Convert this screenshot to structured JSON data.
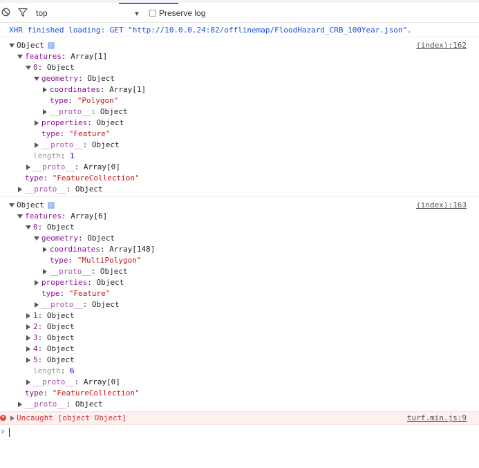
{
  "toolbar": {
    "context_label": "top",
    "preserve_log_label": "Preserve log",
    "preserve_log_checked": false
  },
  "xhr_message": "XHR finished loading: GET \"http://10.0.0.24:82/offlinemap/FloodHazard_CRB_100Year.json\".",
  "log1": {
    "source": "(index):162",
    "lines": {
      "root": "Object",
      "features_key": "features",
      "features_val": "Array[1]",
      "item0_key": "0",
      "item0_val": "Object",
      "geometry_key": "geometry",
      "geometry_val": "Object",
      "coordinates_key": "coordinates",
      "coordinates_val": "Array[1]",
      "gtype_key": "type",
      "gtype_val": "\"Polygon\"",
      "gproto_key": "__proto__",
      "gproto_val": "Object",
      "properties_key": "properties",
      "properties_val": "Object",
      "ftype_key": "type",
      "ftype_val": "\"Feature\"",
      "fproto_key": "__proto__",
      "fproto_val": "Object",
      "length_key": "length",
      "length_val": "1",
      "aproto_key": "__proto__",
      "aproto_val": "Array[0]",
      "type_key": "type",
      "type_val": "\"FeatureCollection\"",
      "proto_key": "__proto__",
      "proto_val": "Object"
    }
  },
  "log2": {
    "source": "(index):163",
    "lines": {
      "root": "Object",
      "features_key": "features",
      "features_val": "Array[6]",
      "item0_key": "0",
      "item0_val": "Object",
      "geometry_key": "geometry",
      "geometry_val": "Object",
      "coordinates_key": "coordinates",
      "coordinates_val": "Array[148]",
      "gtype_key": "type",
      "gtype_val": "\"MultiPolygon\"",
      "gproto_key": "__proto__",
      "gproto_val": "Object",
      "properties_key": "properties",
      "properties_val": "Object",
      "ftype_key": "type",
      "ftype_val": "\"Feature\"",
      "fproto_key": "__proto__",
      "fproto_val": "Object",
      "items": [
        {
          "key": "1",
          "val": "Object"
        },
        {
          "key": "2",
          "val": "Object"
        },
        {
          "key": "3",
          "val": "Object"
        },
        {
          "key": "4",
          "val": "Object"
        },
        {
          "key": "5",
          "val": "Object"
        }
      ],
      "length_key": "length",
      "length_val": "6",
      "aproto_key": "__proto__",
      "aproto_val": "Array[0]",
      "type_key": "type",
      "type_val": "\"FeatureCollection\"",
      "proto_key": "__proto__",
      "proto_val": "Object"
    }
  },
  "error": {
    "icon": "error-x-icon",
    "message": "Uncaught [object Object]",
    "source": "turf.min.js:9"
  },
  "info_badge_glyph": "i",
  "colors": {
    "key": "#881391",
    "string": "#c41a16",
    "number": "#1c00cf",
    "xhr": "#1b4fd8",
    "error": "#d32f2f",
    "error_bg": "#fff0f0"
  }
}
